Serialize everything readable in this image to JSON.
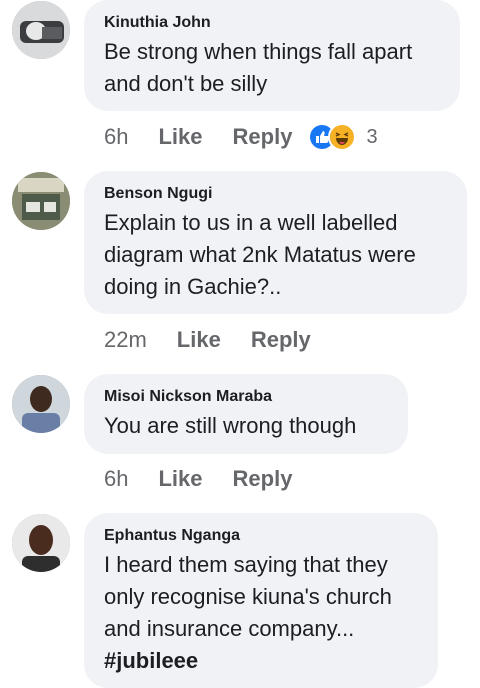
{
  "comments": [
    {
      "author": "Kinuthia John",
      "text": "Be strong when things fall apart\nand don't be silly",
      "hashtag": "",
      "time": "6h",
      "like": "Like",
      "reply": "Reply",
      "reactions": {
        "icons": [
          "like-icon",
          "haha-icon"
        ],
        "count": "3",
        "colors": {
          "like": "#1877f2",
          "haha": "#f7b125"
        }
      }
    },
    {
      "author": "Benson Ngugi",
      "text": "Explain to us in a well labelled\ndiagram what 2nk Matatus were\ndoing in Gachie?..",
      "hashtag": "",
      "time": "22m",
      "like": "Like",
      "reply": "Reply"
    },
    {
      "author": "Misoi Nickson Maraba",
      "text": "You are still wrong though",
      "hashtag": "",
      "time": "6h",
      "like": "Like",
      "reply": "Reply"
    },
    {
      "author": "Ephantus Nganga",
      "text": "I heard them saying that they\nonly recognise kiuna's church\nand insurance company...",
      "hashtag": "#jubileee",
      "time": "",
      "like": "",
      "reply": ""
    }
  ],
  "colors": {
    "bubble": "#f0f2f5",
    "meta": "#65676b",
    "text": "#1c1e21"
  }
}
